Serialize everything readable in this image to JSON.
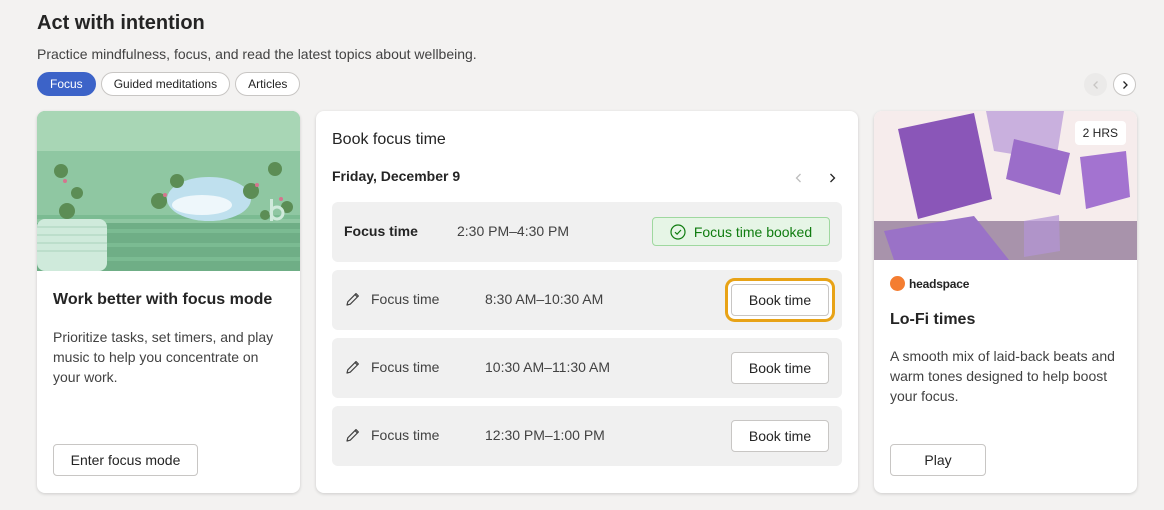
{
  "header": {
    "title": "Act with intention",
    "subtitle": "Practice mindfulness, focus, and read the latest topics about wellbeing."
  },
  "tabs": [
    {
      "label": "Focus",
      "active": true
    },
    {
      "label": "Guided meditations",
      "active": false
    },
    {
      "label": "Articles",
      "active": false
    }
  ],
  "focus_card": {
    "title": "Work better with focus mode",
    "description": "Prioritize tasks, set timers, and play music to help you concentrate on your work.",
    "button_label": "Enter focus mode"
  },
  "book_card": {
    "title": "Book focus time",
    "date": "Friday, December 9",
    "slots": [
      {
        "label": "Focus time",
        "time": "2:30 PM–4:30 PM",
        "status": "Focus time booked"
      },
      {
        "label": "Focus time",
        "time": "8:30 AM–10:30 AM",
        "button": "Book time"
      },
      {
        "label": "Focus time",
        "time": "10:30 AM–11:30 AM",
        "button": "Book time"
      },
      {
        "label": "Focus time",
        "time": "12:30 PM–1:00 PM",
        "button": "Book time"
      }
    ]
  },
  "music_card": {
    "badge": "2 HRS",
    "brand": "headspace",
    "title": "Lo-Fi times",
    "description": "A smooth mix of laid-back beats and warm tones designed to help boost your focus.",
    "button_label": "Play"
  },
  "colors": {
    "accent": "#3c63c8",
    "success": "#107c10",
    "focus_ring": "#e8a317",
    "brand_orange": "#f47d31"
  },
  "icons": [
    "chevron-left-icon",
    "chevron-right-icon",
    "pencil-icon",
    "check-circle-icon",
    "headspace-logo-icon"
  ]
}
